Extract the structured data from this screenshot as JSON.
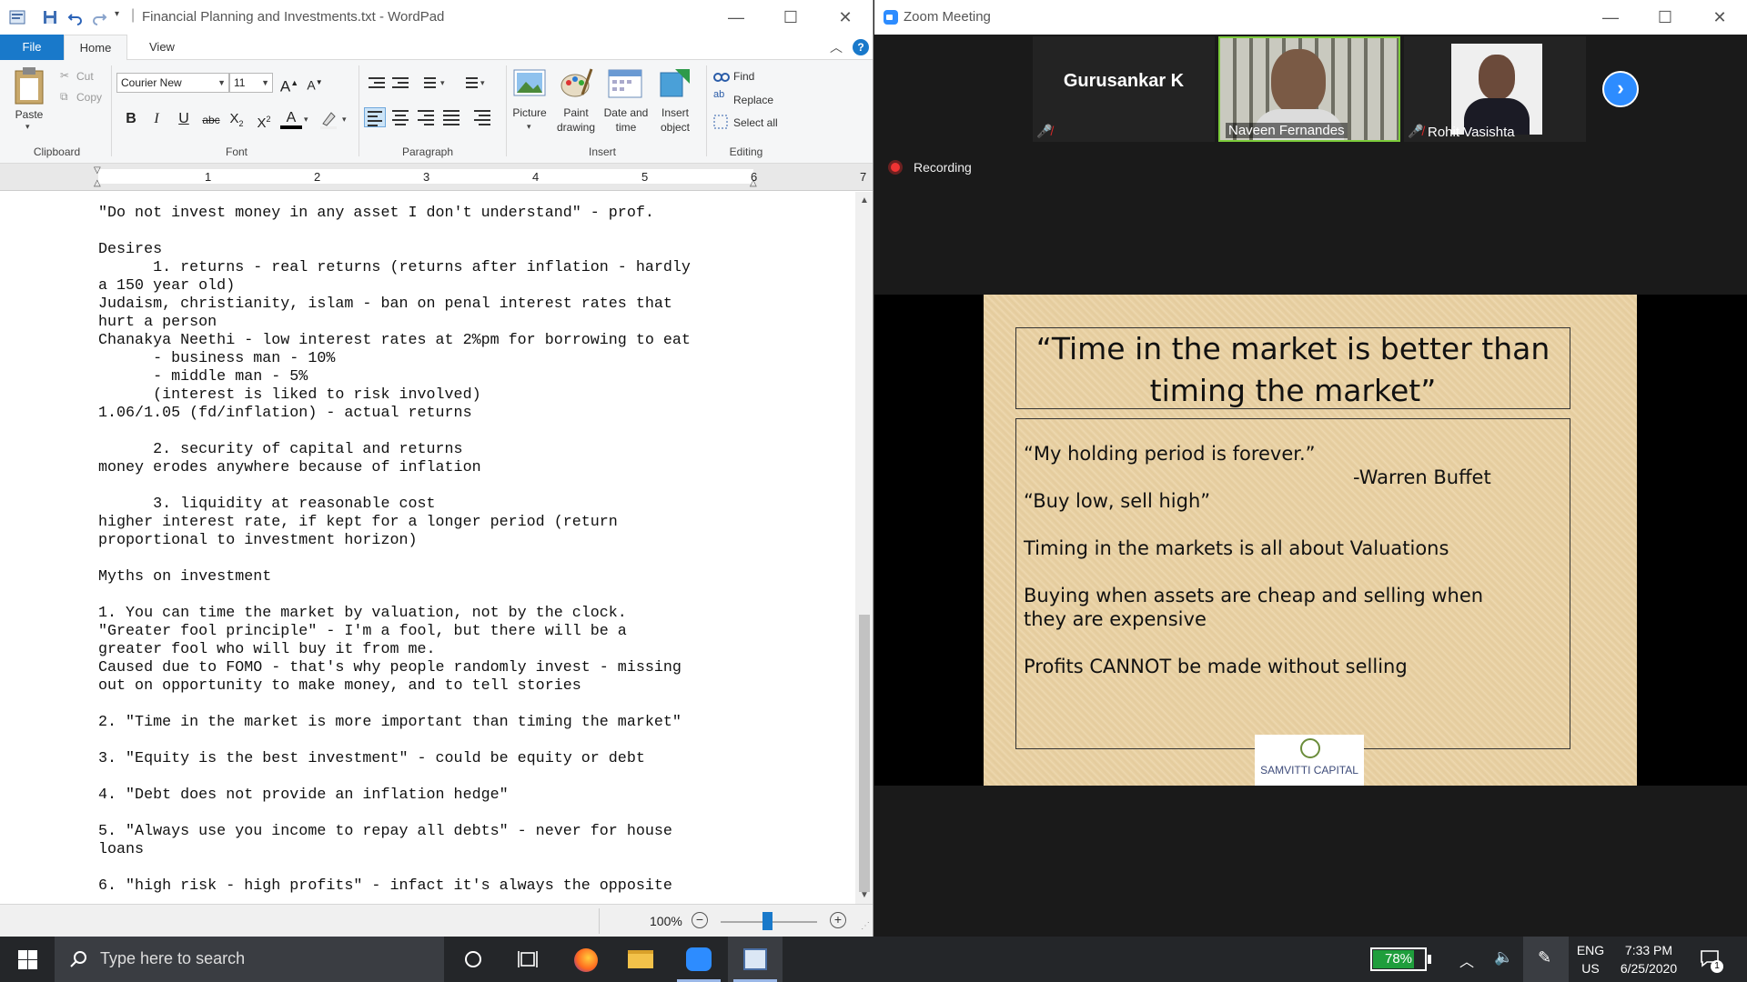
{
  "wordpad": {
    "title": "Financial Planning and Investments.txt - WordPad",
    "tabs": {
      "file": "File",
      "home": "Home",
      "view": "View"
    },
    "clipboard": {
      "paste": "Paste",
      "cut": "Cut",
      "copy": "Copy",
      "group": "Clipboard"
    },
    "font": {
      "family": "Courier New",
      "size": "11",
      "group": "Font"
    },
    "paragraph": {
      "group": "Paragraph"
    },
    "insert": {
      "picture": "Picture",
      "paint_drawing": "Paint drawing",
      "date_time": "Date and time",
      "insert_object": "Insert object",
      "group": "Insert"
    },
    "editing": {
      "find": "Find",
      "replace": "Replace",
      "select_all": "Select all",
      "group": "Editing"
    },
    "ruler": [
      "1",
      "2",
      "3",
      "4",
      "5",
      "6",
      "7"
    ],
    "document_text": "\"Do not invest money in any asset I don't understand\" - prof.\n\nDesires\n      1. returns - real returns (returns after inflation - hardly\na 150 year old)\nJudaism, christianity, islam - ban on penal interest rates that\nhurt a person\nChanakya Neethi - low interest rates at 2%pm for borrowing to eat\n      - business man - 10%\n      - middle man - 5%\n      (interest is liked to risk involved)\n1.06/1.05 (fd/inflation) - actual returns\n\n      2. security of capital and returns\nmoney erodes anywhere because of inflation\n\n      3. liquidity at reasonable cost\nhigher interest rate, if kept for a longer period (return\nproportional to investment horizon)\n\nMyths on investment\n\n1. You can time the market by valuation, not by the clock.\n\"Greater fool principle\" - I'm a fool, but there will be a\ngreater fool who will buy it from me.\nCaused due to FOMO - that's why people randomly invest - missing\nout on opportunity to make money, and to tell stories\n\n2. \"Time in the market is more important than timing the market\"\n\n3. \"Equity is the best investment\" - could be equity or debt\n\n4. \"Debt does not provide an inflation hedge\"\n\n5. \"Always use you income to repay all debts\" - never for house\nloans\n\n6. \"high risk - high profits\" - infact it's always the opposite",
    "zoom_level": "100%"
  },
  "zoom": {
    "title": "Zoom Meeting",
    "participants": [
      "Gurusankar K",
      "Naveen Fernandes",
      "Rohit Vasishta"
    ],
    "recording_label": "Recording",
    "slide": {
      "title_line1": "“Time in the market is better than",
      "title_line2": "timing the market”",
      "quote1": "“My holding period is forever.”",
      "quote1_author": "-Warren Buffet",
      "quote2": "“Buy low, sell high”",
      "point1": "Timing in the markets is all about Valuations",
      "point2_line1": "Buying when assets are cheap and selling when",
      "point2_line2": "they are expensive",
      "point3": "Profits CANNOT be made without selling",
      "logo_text": "SAMVITTI CAPITAL"
    }
  },
  "taskbar": {
    "search_placeholder": "Type here to search",
    "battery": "78%",
    "language_top": "ENG",
    "language_bottom": "US",
    "time": "7:33 PM",
    "date": "6/25/2020",
    "notification_count": "1"
  },
  "colors": {
    "accent": "#1979ca",
    "zoom_blue": "#2d8cff",
    "mute_red": "#e02828",
    "battery_green": "#1f9e3c"
  }
}
